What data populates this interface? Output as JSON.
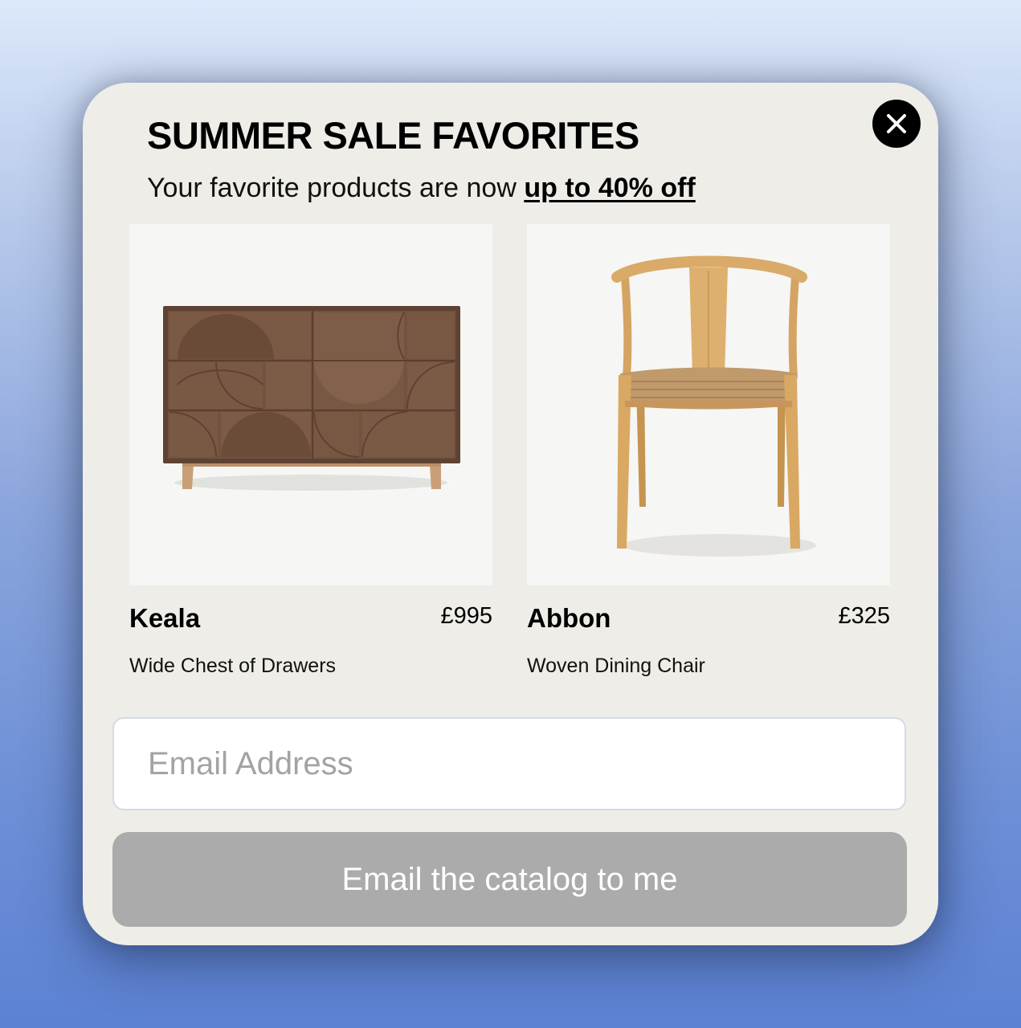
{
  "popup": {
    "title": "SUMMER SALE FAVORITES",
    "subtitle_prefix": "Your favorite products are now ",
    "subtitle_highlight": "up to 40% off",
    "close_icon": "close-icon"
  },
  "products": [
    {
      "name": "Keala",
      "price": "£995",
      "description": "Wide Chest of Drawers",
      "image": "chest-of-drawers-image"
    },
    {
      "name": "Abbon",
      "price": "£325",
      "description": "Woven Dining Chair",
      "image": "dining-chair-image"
    }
  ],
  "form": {
    "email_placeholder": "Email Address",
    "email_value": "",
    "submit_label": "Email the catalog to me"
  },
  "colors": {
    "popup_background": "#eeede7",
    "button_background": "#ababab",
    "close_button": "#000000"
  }
}
